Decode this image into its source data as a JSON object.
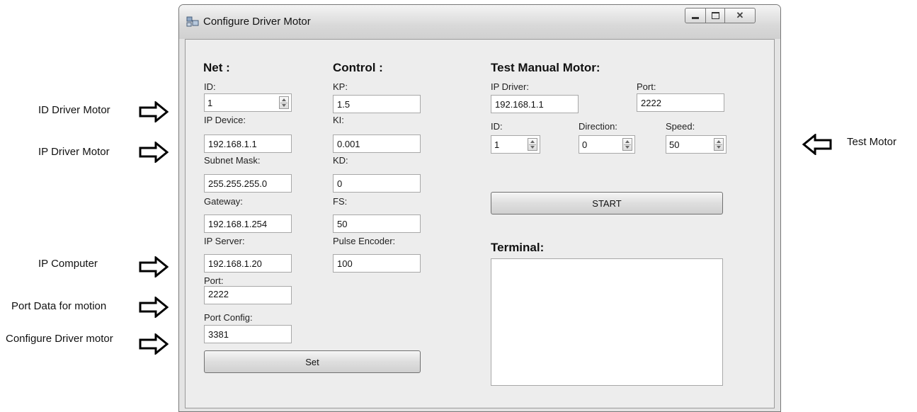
{
  "annotations": {
    "id_driver_motor": "ID Driver Motor",
    "ip_driver_motor": "IP Driver Motor",
    "ip_computer": "IP Computer",
    "port_data": "Port Data for motion",
    "configure_driver": "Configure Driver motor",
    "test_motor": "Test Motor"
  },
  "window": {
    "title": "Configure Driver Motor"
  },
  "net": {
    "heading": "Net :",
    "id_label": "ID:",
    "id_value": "1",
    "ip_device_label": "IP Device:",
    "ip_device_value": "192.168.1.1",
    "subnet_label": "Subnet Mask:",
    "subnet_value": "255.255.255.0",
    "gateway_label": "Gateway:",
    "gateway_value": "192.168.1.254",
    "ip_server_label": "IP Server:",
    "ip_server_value": "192.168.1.20",
    "port_label": "Port:",
    "port_value": "2222",
    "port_config_label": "Port Config:",
    "port_config_value": "3381",
    "set_button": "Set"
  },
  "control": {
    "heading": "Control :",
    "kp_label": "KP:",
    "kp_value": "1.5",
    "ki_label": "KI:",
    "ki_value": "0.001",
    "kd_label": "KD:",
    "kd_value": "0",
    "fs_label": "FS:",
    "fs_value": "50",
    "pulse_label": "Pulse Encoder:",
    "pulse_value": "100"
  },
  "test": {
    "heading": "Test Manual Motor:",
    "ip_driver_label": "IP Driver:",
    "ip_driver_value": "192.168.1.1",
    "port_label": "Port:",
    "port_value": "2222",
    "id_label": "ID:",
    "id_value": "1",
    "direction_label": "Direction:",
    "direction_value": "0",
    "speed_label": "Speed:",
    "speed_value": "50",
    "start_button": "START",
    "terminal_heading": "Terminal:"
  }
}
